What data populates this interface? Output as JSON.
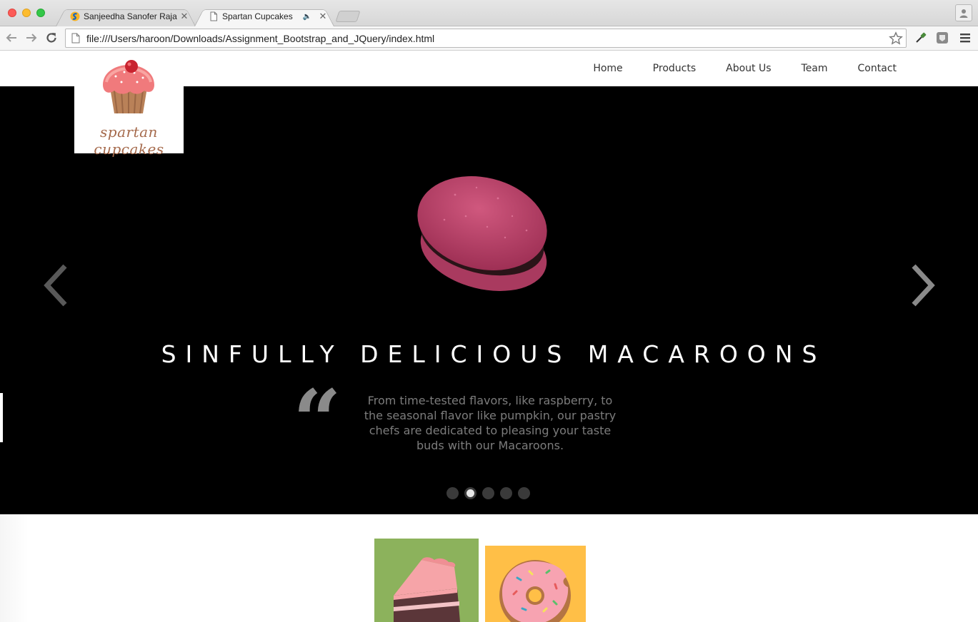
{
  "browser": {
    "tabs": [
      {
        "title": "Sanjeedha Sanofer Raja",
        "active": false
      },
      {
        "title": "Spartan Cupcakes",
        "active": true
      }
    ],
    "url": "file:///Users/haroon/Downloads/Assignment_Bootstrap_and_JQuery/index.html"
  },
  "site": {
    "logo_text": "spartan cupcakes",
    "nav": [
      "Home",
      "Products",
      "About Us",
      "Team",
      "Contact"
    ]
  },
  "carousel": {
    "heading": "SINFULLY DELICIOUS MACAROONS",
    "quote": "From time-tested flavors, like raspberry, to the seasonal flavor like pumpkin, our pastry chefs are dedicated to pleasing your taste buds with our Macaroons.",
    "slide_count": 5,
    "active_index": 1
  },
  "colors": {
    "carousel_bg": "#000000",
    "cake_tile": "#8cb25c",
    "donut_tile": "#ffbf47",
    "macaron": "#c1466e",
    "logo_text": "#a56a4c"
  }
}
